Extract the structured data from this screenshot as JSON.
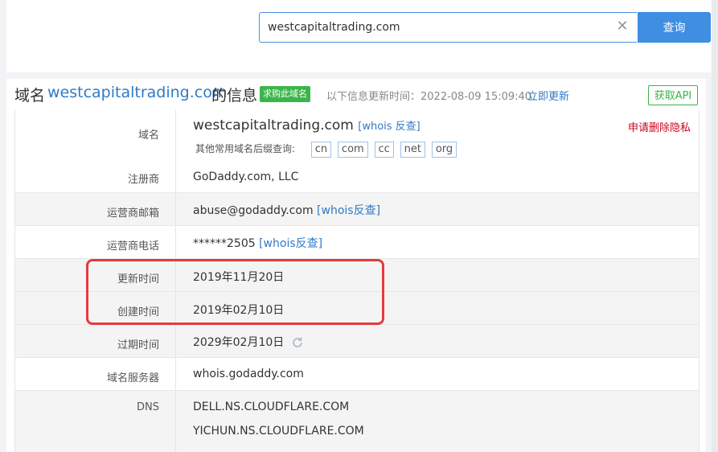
{
  "search": {
    "value": "westcapitaltrading.com",
    "button_label": "查询"
  },
  "header": {
    "title_prefix": "域名",
    "title_domain": "westcapitaltrading.com",
    "title_suffix": "的信息",
    "buy_badge": "求购此域名",
    "update_label": "以下信息更新时间：2022-08-09 15:09:40",
    "update_link": "立即更新",
    "api_button": "获取API"
  },
  "rows": {
    "domain": {
      "label": "域名",
      "value": "westcapitaltrading.com",
      "whois_link": "[whois 反查]",
      "privacy_link": "申请删除隐私",
      "suffix_label": "其他常用域名后缀查询:",
      "suffixes": [
        "cn",
        "com",
        "cc",
        "net",
        "org"
      ]
    },
    "registrar": {
      "label": "注册商",
      "value": "GoDaddy.com, LLC"
    },
    "email": {
      "label": "运营商邮箱",
      "value": "abuse@godaddy.com",
      "link": "[whois反查]"
    },
    "phone": {
      "label": "运营商电话",
      "value": "******2505",
      "link": "[whois反查]"
    },
    "updated": {
      "label": "更新时间",
      "value": "2019年11月20日"
    },
    "created": {
      "label": "创建时间",
      "value": "2019年02月10日"
    },
    "expires": {
      "label": "过期时间",
      "value": "2029年02月10日"
    },
    "nameserver": {
      "label": "域名服务器",
      "value": "whois.godaddy.com"
    },
    "dns": {
      "label": "DNS",
      "values": [
        "DELL.NS.CLOUDFLARE.COM",
        "YICHUN.NS.CLOUDFLARE.COM"
      ]
    }
  },
  "colors": {
    "accent": "#3e8ee2",
    "link": "#2f7ac7",
    "badge_green": "#3ab54a",
    "highlight_red": "#e43b3b"
  }
}
